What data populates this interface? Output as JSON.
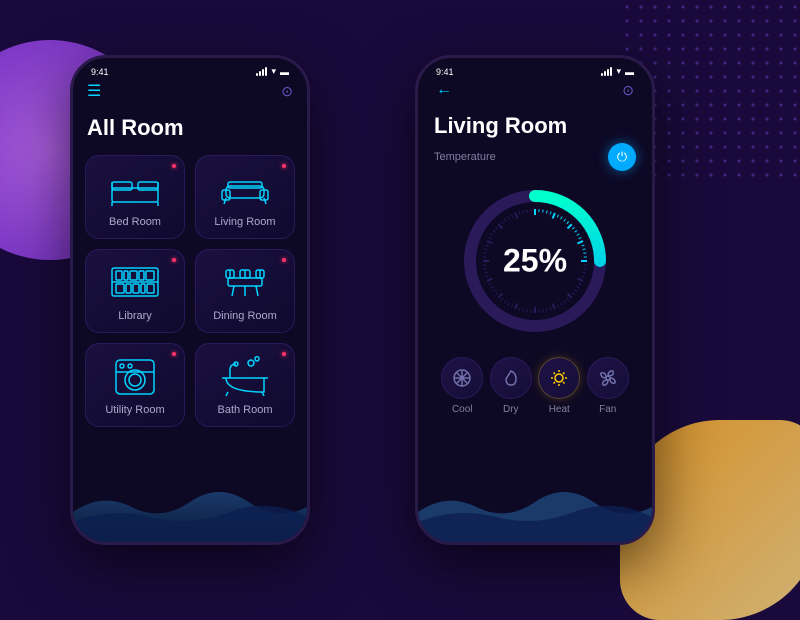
{
  "background": {
    "color": "#1a0a3c"
  },
  "left_phone": {
    "status_time": "9:41",
    "title": "All Room",
    "rooms": [
      {
        "id": "bedroom",
        "label": "Bed Room",
        "icon": "bed"
      },
      {
        "id": "livingroom",
        "label": "Living Room",
        "icon": "sofa"
      },
      {
        "id": "library",
        "label": "Library",
        "icon": "bookshelf"
      },
      {
        "id": "diningroom",
        "label": "Dining Room",
        "icon": "diningtable"
      },
      {
        "id": "utilityroom",
        "label": "Utility Room",
        "icon": "washer"
      },
      {
        "id": "bathroom",
        "label": "Bath Room",
        "icon": "bathtub"
      }
    ]
  },
  "right_phone": {
    "status_time": "9:41",
    "title": "Living Room",
    "temp_label": "Temperature",
    "gauge_value": "25%",
    "controls": [
      {
        "id": "cool",
        "label": "Cool",
        "icon": "❄",
        "active": false
      },
      {
        "id": "dry",
        "label": "Dry",
        "icon": "💧",
        "active": false
      },
      {
        "id": "heat",
        "label": "Heat",
        "icon": "☀",
        "active": true
      },
      {
        "id": "fan",
        "label": "Fan",
        "icon": "⚙",
        "active": false
      }
    ]
  }
}
